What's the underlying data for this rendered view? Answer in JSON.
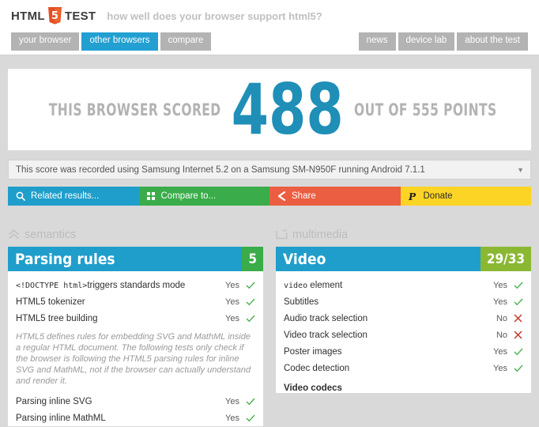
{
  "header": {
    "logo_html": "HTML TEST",
    "logo_pre": "HTML",
    "logo_post": "TEST",
    "logo_digit": "5",
    "tagline": "how well does your browser support html5?",
    "nav_left": [
      {
        "label": "your browser",
        "active": false
      },
      {
        "label": "other browsers",
        "active": true
      },
      {
        "label": "compare",
        "active": false
      }
    ],
    "nav_right": [
      {
        "label": "news"
      },
      {
        "label": "device lab"
      },
      {
        "label": "about the test"
      }
    ]
  },
  "score": {
    "prefix": "THIS BROWSER SCORED",
    "value": "488",
    "suffix": "OUT OF 555 POINTS"
  },
  "selectbar": {
    "text": "This score was recorded using Samsung Internet 5.2 on a Samsung SM-N950F running Android 7.1.1",
    "caret": "▼"
  },
  "actions": [
    {
      "label": "Related results...",
      "icon": "search-icon",
      "color": "#1f9ecb"
    },
    {
      "label": "Compare to...",
      "icon": "grid-icon",
      "color": "#3aac4a"
    },
    {
      "label": "Share",
      "icon": "share-icon",
      "color": "#ec5e41"
    },
    {
      "label": "Donate",
      "icon": "paypal-icon",
      "color": "#fcd425"
    }
  ],
  "columns": [
    {
      "category": "semantics",
      "category_icon": "double-chevron-up-icon",
      "section_title": "Parsing rules",
      "section_badge": "5",
      "badge_color": "#3aac4a",
      "rows": [
        {
          "name": "triggers standards mode",
          "code": "<!DOCTYPE html>",
          "value": "Yes",
          "mark": "check"
        },
        {
          "name": "HTML5 tokenizer",
          "value": "Yes",
          "mark": "check"
        },
        {
          "name": "HTML5 tree building",
          "value": "Yes",
          "mark": "check"
        }
      ],
      "note": "HTML5 defines rules for embedding SVG and MathML inside a regular HTML document. The following tests only check if the browser is following the HTML5 parsing rules for inline SVG and MathML, not if the browser can actually understand and render it.",
      "rows_after": [
        {
          "name": "Parsing inline SVG",
          "value": "Yes",
          "mark": "check"
        },
        {
          "name": "Parsing inline MathML",
          "value": "Yes",
          "mark": "check"
        }
      ]
    },
    {
      "category": "multimedia",
      "category_icon": "monitor-icon",
      "section_title": "Video",
      "section_badge": "29/33",
      "badge_color": "#8ab833",
      "rows": [
        {
          "name": " element",
          "code": "video",
          "value": "Yes",
          "mark": "check"
        },
        {
          "name": "Subtitles",
          "value": "Yes",
          "mark": "check"
        },
        {
          "name": "Audio track selection",
          "value": "No",
          "mark": "cross"
        },
        {
          "name": "Video track selection",
          "value": "No",
          "mark": "cross"
        },
        {
          "name": "Poster images",
          "value": "Yes",
          "mark": "check"
        },
        {
          "name": "Codec detection",
          "value": "Yes",
          "mark": "check"
        }
      ],
      "subhead": "Video codecs"
    }
  ],
  "colors": {
    "brand_blue": "#1f9ecb",
    "green": "#3aac4a",
    "olive": "#8ab833",
    "orange": "#ec5e41",
    "yellow": "#fcd425",
    "page_bg": "#d9d9d9"
  }
}
